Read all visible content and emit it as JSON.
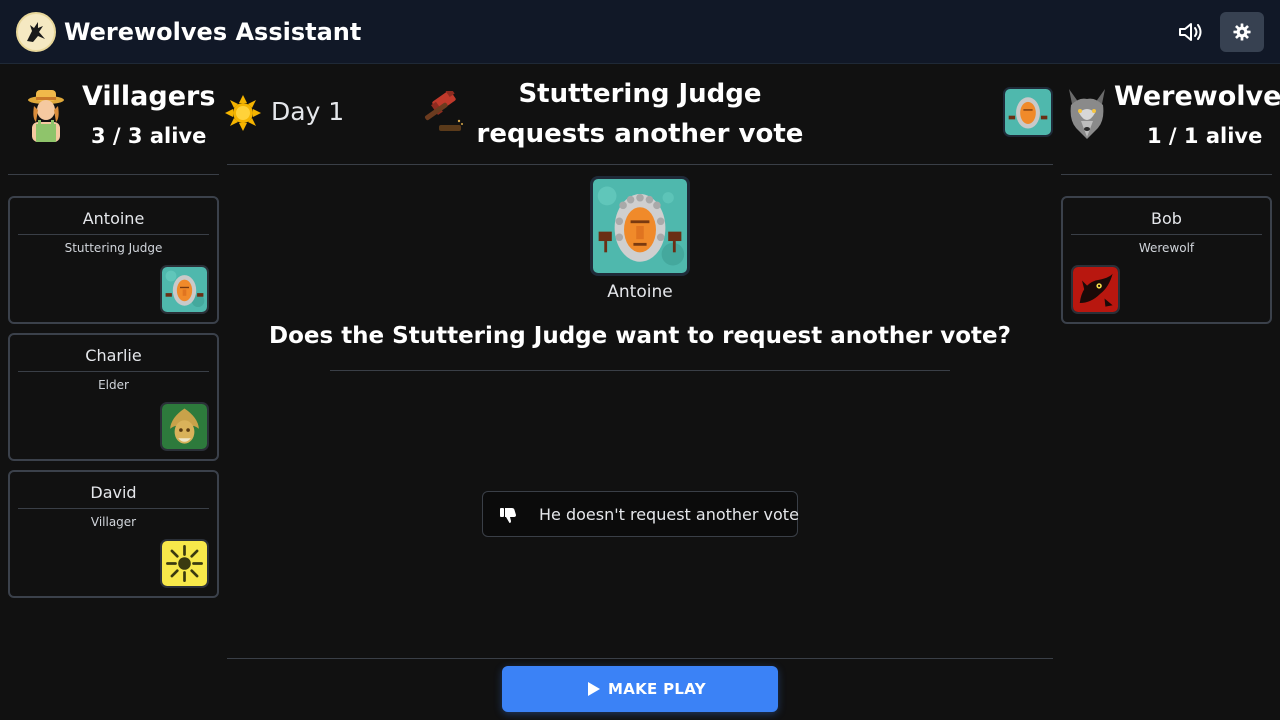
{
  "header": {
    "title": "Werewolves Assistant",
    "logo_icon": "howling-wolf-icon",
    "sound_icon": "speaker-icon",
    "settings_icon": "gear-icon"
  },
  "villagers": {
    "name": "Villagers",
    "alive": "3 / 3 alive",
    "icon": "farmer-icon",
    "players": [
      {
        "name": "Antoine",
        "role": "Stuttering Judge",
        "role_icon": "stuttering-judge-card"
      },
      {
        "name": "Charlie",
        "role": "Elder",
        "role_icon": "elder-card"
      },
      {
        "name": "David",
        "role": "Villager",
        "role_icon": "villager-card"
      }
    ]
  },
  "werewolves": {
    "name": "Werewolves",
    "alive": "1 / 1 alive",
    "icon": "wolf-icon",
    "players": [
      {
        "name": "Bob",
        "role": "Werewolf",
        "role_icon": "werewolf-card"
      }
    ]
  },
  "game": {
    "phase": "Day 1",
    "phase_icon": "sun-icon",
    "event_icon": "gavel-icon",
    "event_title_line1": "Stuttering Judge",
    "event_title_line2": "requests another vote",
    "target_player": "Antoine",
    "question": "Does the Stuttering Judge want to request another vote?",
    "choice_label": "He doesn't request another vote",
    "play_label": "MAKE PLAY"
  },
  "colors": {
    "background": "#111111",
    "header": "#111827",
    "accent": "#3b82f6",
    "border": "#3b414b"
  }
}
